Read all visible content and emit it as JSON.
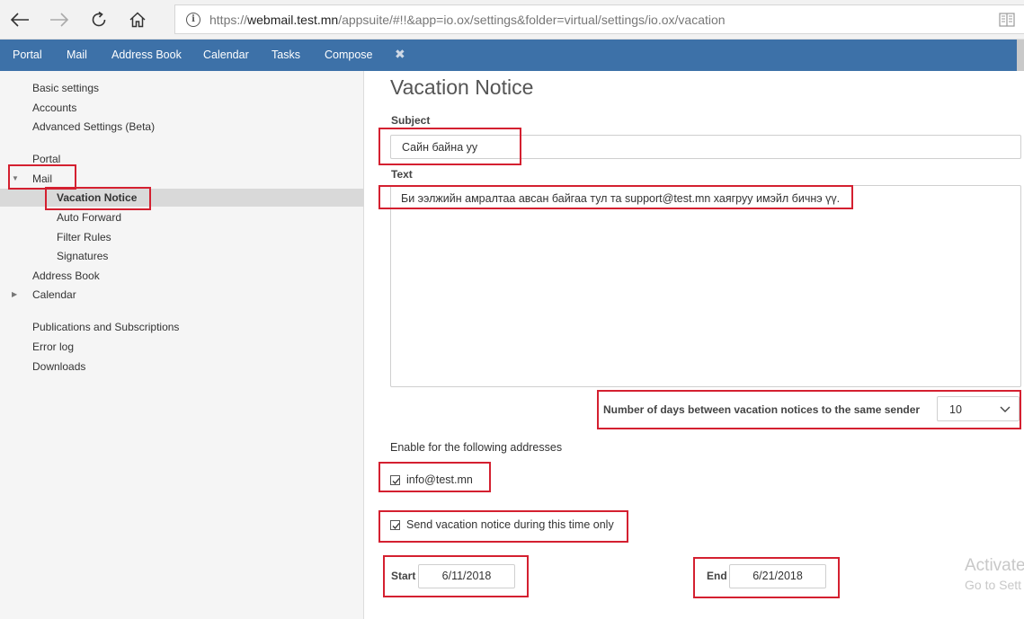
{
  "browser": {
    "url_prefix": "https://",
    "url_host": "webmail.test.mn",
    "url_path": "/appsuite/#!!&app=io.ox/settings&folder=virtual/settings/io.ox/vacation"
  },
  "app_bar": {
    "tabs": [
      "Portal",
      "Mail",
      "Address Book",
      "Calendar",
      "Tasks",
      "Compose"
    ],
    "close_glyph": "✖"
  },
  "sidebar": {
    "items": {
      "basic": "Basic settings",
      "accounts": "Accounts",
      "advanced": "Advanced Settings (Beta)",
      "portal": "Portal",
      "mail": "Mail",
      "vacation": "Vacation Notice",
      "auto_forward": "Auto Forward",
      "filter_rules": "Filter Rules",
      "signatures": "Signatures",
      "address_book": "Address Book",
      "calendar": "Calendar",
      "publications": "Publications and Subscriptions",
      "error_log": "Error log",
      "downloads": "Downloads"
    }
  },
  "main": {
    "title": "Vacation Notice",
    "subject_label": "Subject",
    "subject_value": "Сайн байна уу",
    "text_label": "Text",
    "text_value": "Би ээлжийн амралтаа авсан байгаа тул та support@test.mn хаягруу имэйл бичнэ үү.",
    "days_label": "Number of days between vacation notices to the same sender",
    "days_value": "10",
    "enable_label": "Enable for the following addresses",
    "address_1": "info@test.mn",
    "address_1_checked": true,
    "time_only_label": "Send vacation notice during this time only",
    "time_only_checked": true,
    "start_label": "Start",
    "start_value": "6/11/2018",
    "end_label": "End",
    "end_value": "6/21/2018"
  },
  "watermark": {
    "line1": "Activate",
    "line2": "Go to Sett"
  },
  "colors": {
    "app_bar": "#3d71a8",
    "annotation": "#d42030",
    "sidebar_bg": "#f5f5f5",
    "selected_bg": "#d9d9d9"
  }
}
